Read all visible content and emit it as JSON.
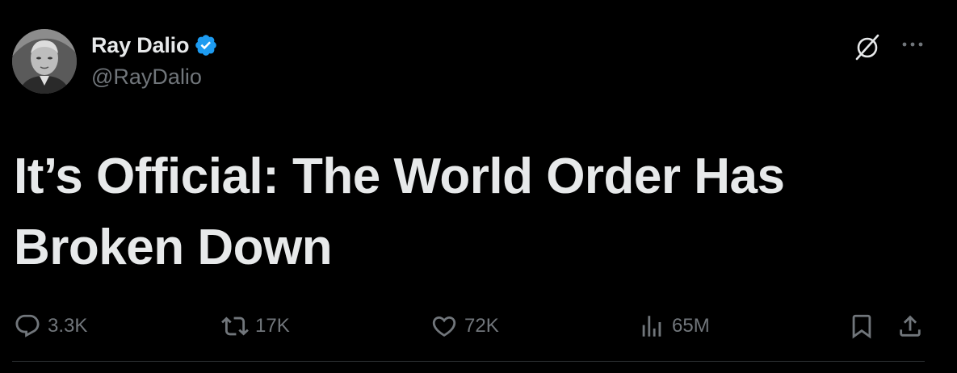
{
  "author": {
    "display_name": "Ray Dalio",
    "handle": "@RayDalio",
    "verified": true
  },
  "tweet": {
    "text": "It’s Official: The World Order Has Broken Down"
  },
  "actions": {
    "replies": "3.3K",
    "reposts": "17K",
    "likes": "72K",
    "views": "65M"
  },
  "icons": {
    "reply": "reply-icon",
    "repost": "repost-icon",
    "like": "heart-icon",
    "views": "views-icon",
    "bookmark": "bookmark-icon",
    "share": "share-icon",
    "grok": "grok-icon",
    "more": "more-icon",
    "verified": "verified-badge-icon"
  },
  "colors": {
    "background": "#000000",
    "text_primary": "#e7e9ea",
    "text_secondary": "#71767b",
    "verified_blue": "#1d9bf0",
    "divider": "#2f3336"
  }
}
